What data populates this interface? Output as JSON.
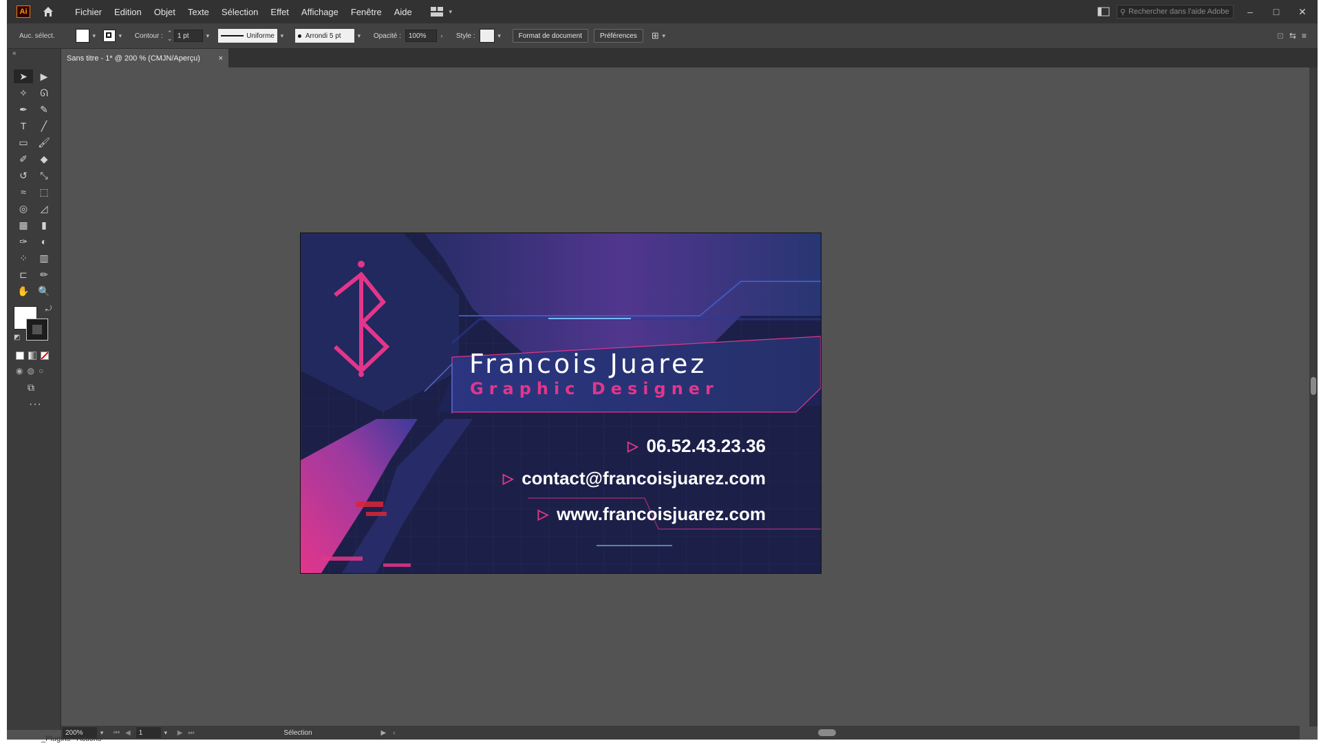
{
  "app": {
    "logo": "Ai",
    "menu": [
      "Fichier",
      "Edition",
      "Objet",
      "Texte",
      "Sélection",
      "Effet",
      "Affichage",
      "Fenêtre",
      "Aide"
    ],
    "search_placeholder": "Rechercher dans l'aide Adobe",
    "window_controls": [
      "–",
      "□",
      "✕"
    ]
  },
  "control_bar": {
    "selection_label": "Auc. sélect.",
    "contour_label": "Contour :",
    "stroke_weight": "1 pt",
    "stroke_profile": "Uniforme",
    "brush": "Arrondi 5 pt",
    "opacity_label": "Opacité :",
    "opacity_value": "100%",
    "style_label": "Style :",
    "doc_setup_button": "Format de document",
    "prefs_button": "Préférences"
  },
  "document_tab": {
    "title": "Sans titre - 1* @ 200 % (CMJN/Aperçu)",
    "close": "×"
  },
  "artboard": {
    "name": "Francois Juarez",
    "job_title": "Graphic Designer",
    "phone": "06.52.43.23.36",
    "email": "contact@francoisjuarez.com",
    "website": "www.francoisjuarez.com",
    "colors": {
      "background": "#1f2350",
      "accent_pink": "#e2368b",
      "accent_purple": "#7a3aa6",
      "text": "#ffffff"
    }
  },
  "status_bar": {
    "zoom": "200%",
    "page": "1",
    "tool": "Sélection"
  },
  "taskbar_ghost": "_Plugins - Actions"
}
